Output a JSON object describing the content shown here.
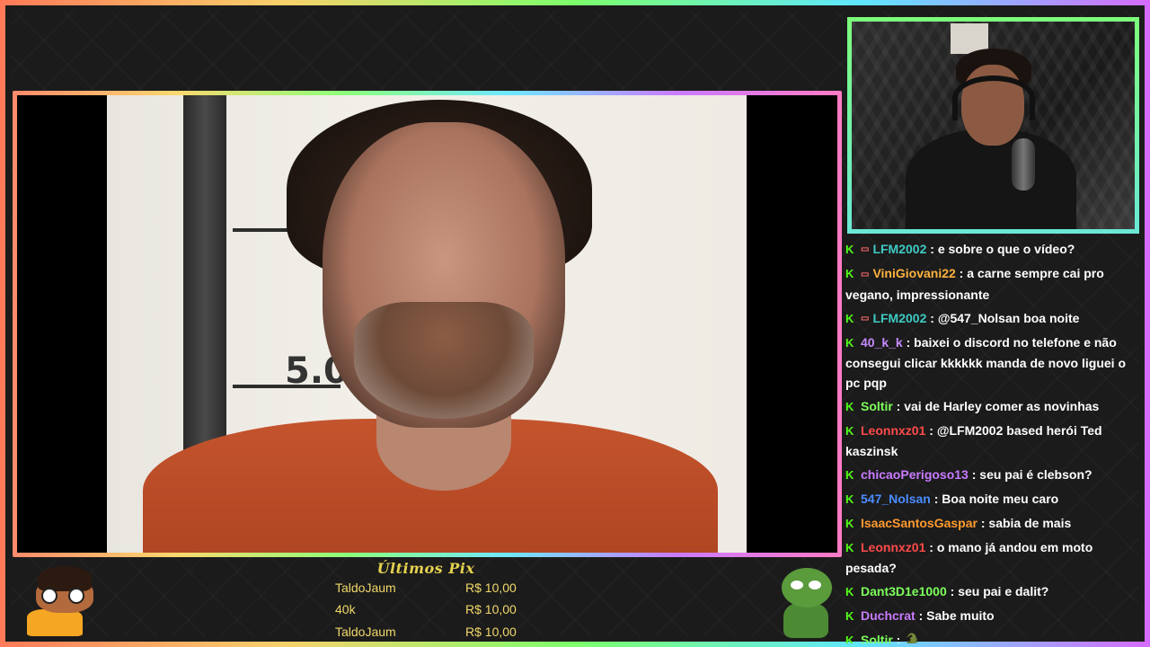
{
  "chat": [
    {
      "user": "LFM2002",
      "color": "#3ecbc4",
      "sub": true,
      "text": "e sobre o que o vídeo?"
    },
    {
      "user": "ViniGiovani22",
      "color": "#ffb23e",
      "sub": true,
      "text": "a carne sempre cai pro vegano, impressionante"
    },
    {
      "user": "LFM2002",
      "color": "#3ecbc4",
      "sub": true,
      "text": "@547_Nolsan boa noite"
    },
    {
      "user": "40_k_k",
      "color": "#c78bff",
      "sub": false,
      "text": "baixei o discord no telefone e não consegui clicar kkkkkk manda de novo liguei o pc pqp"
    },
    {
      "user": "Soltir",
      "color": "#7dff5a",
      "sub": false,
      "text": "vai de Harley comer as novinhas"
    },
    {
      "user": "Leonnxz01",
      "color": "#ff4a4a",
      "sub": false,
      "text": "@LFM2002 based herói Ted kaszinsk"
    },
    {
      "user": "chicaoPerigoso13",
      "color": "#c97bff",
      "sub": false,
      "text": "seu pai é clebson?"
    },
    {
      "user": "547_Nolsan",
      "color": "#4a8cff",
      "sub": false,
      "text": "Boa noite meu caro"
    },
    {
      "user": "IsaacSantosGaspar",
      "color": "#ff9a2e",
      "sub": false,
      "text": "sabia de mais"
    },
    {
      "user": "Leonnxz01",
      "color": "#ff4a4a",
      "sub": false,
      "text": "o mano já andou em moto pesada?"
    },
    {
      "user": "Dant3D1e1000",
      "color": "#7dff5a",
      "sub": false,
      "text": "seu pai e dalit?"
    },
    {
      "user": "Duchcrat",
      "color": "#c97bff",
      "sub": false,
      "text": "Sabe muito"
    },
    {
      "user": "Soltir",
      "color": "#7dff5a",
      "sub": false,
      "text": "🐊"
    }
  ],
  "pix": {
    "title": "Últimos Pix",
    "rows": [
      {
        "name": "TaldoJaum",
        "value": "R$ 10,00"
      },
      {
        "name": "40k",
        "value": "R$ 10,00"
      },
      {
        "name": "TaldoJaum",
        "value": "R$ 10,00"
      }
    ]
  },
  "video": {
    "mug_numbers": [
      "5",
      "5.0"
    ]
  },
  "icons": {
    "badge": "kick-badge-icon",
    "sub": "subscriber-badge-icon"
  },
  "colors": {
    "frame_gradient": [
      "#ff7a59",
      "#f7d26b",
      "#7cff6b",
      "#5fe6ff",
      "#d66bff"
    ],
    "kick_green": "#53fc18"
  }
}
